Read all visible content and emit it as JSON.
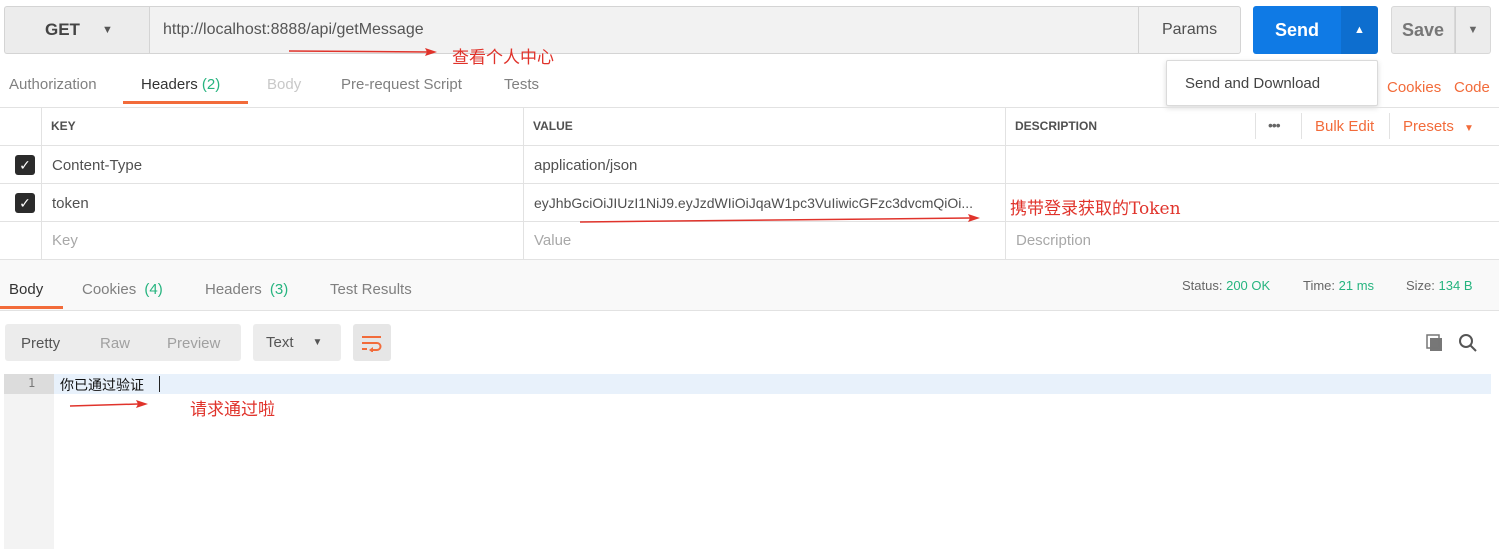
{
  "request": {
    "method": "GET",
    "url": "http://localhost:8888/api/getMessage",
    "params_label": "Params",
    "send_label": "Send",
    "save_label": "Save",
    "dropdown_item": "Send and Download"
  },
  "request_tabs": [
    {
      "label": "Authorization"
    },
    {
      "label": "Headers",
      "count": "(2)"
    },
    {
      "label": "Body"
    },
    {
      "label": "Pre-request Script"
    },
    {
      "label": "Tests"
    }
  ],
  "right_links": {
    "cookies": "Cookies",
    "code": "Code"
  },
  "headers_table": {
    "columns": [
      "KEY",
      "VALUE",
      "DESCRIPTION"
    ],
    "more": "•••",
    "bulk_edit": "Bulk Edit",
    "presets": "Presets",
    "rows": [
      {
        "checked": true,
        "key": "Content-Type",
        "value": "application/json",
        "description": ""
      },
      {
        "checked": true,
        "key": "token",
        "value": "eyJhbGciOiJIUzI1NiJ9.eyJzdWIiOiJqaW1pc3VuIiwicGFzc3dvcmQiOi...",
        "description": ""
      }
    ],
    "placeholders": {
      "key": "Key",
      "value": "Value",
      "description": "Description"
    }
  },
  "response_tabs": [
    {
      "label": "Body"
    },
    {
      "label": "Cookies",
      "count": "(4)"
    },
    {
      "label": "Headers",
      "count": "(3)"
    },
    {
      "label": "Test Results"
    }
  ],
  "status": {
    "status_label": "Status:",
    "status_value": "200 OK",
    "time_label": "Time:",
    "time_value": "21 ms",
    "size_label": "Size:",
    "size_value": "134 B"
  },
  "format": {
    "pretty": "Pretty",
    "raw": "Raw",
    "preview": "Preview",
    "type": "Text"
  },
  "editor": {
    "line_number": "1",
    "line_text": "你已通过验证"
  },
  "annotations": {
    "url_note": "查看个人中心",
    "token_note": "携带登录获取的Token",
    "body_note": "请求通过啦"
  },
  "colors": {
    "accent": "#f26b3a",
    "send": "#0f7ae5",
    "success": "#26b47f",
    "annotation": "#e0332b"
  }
}
